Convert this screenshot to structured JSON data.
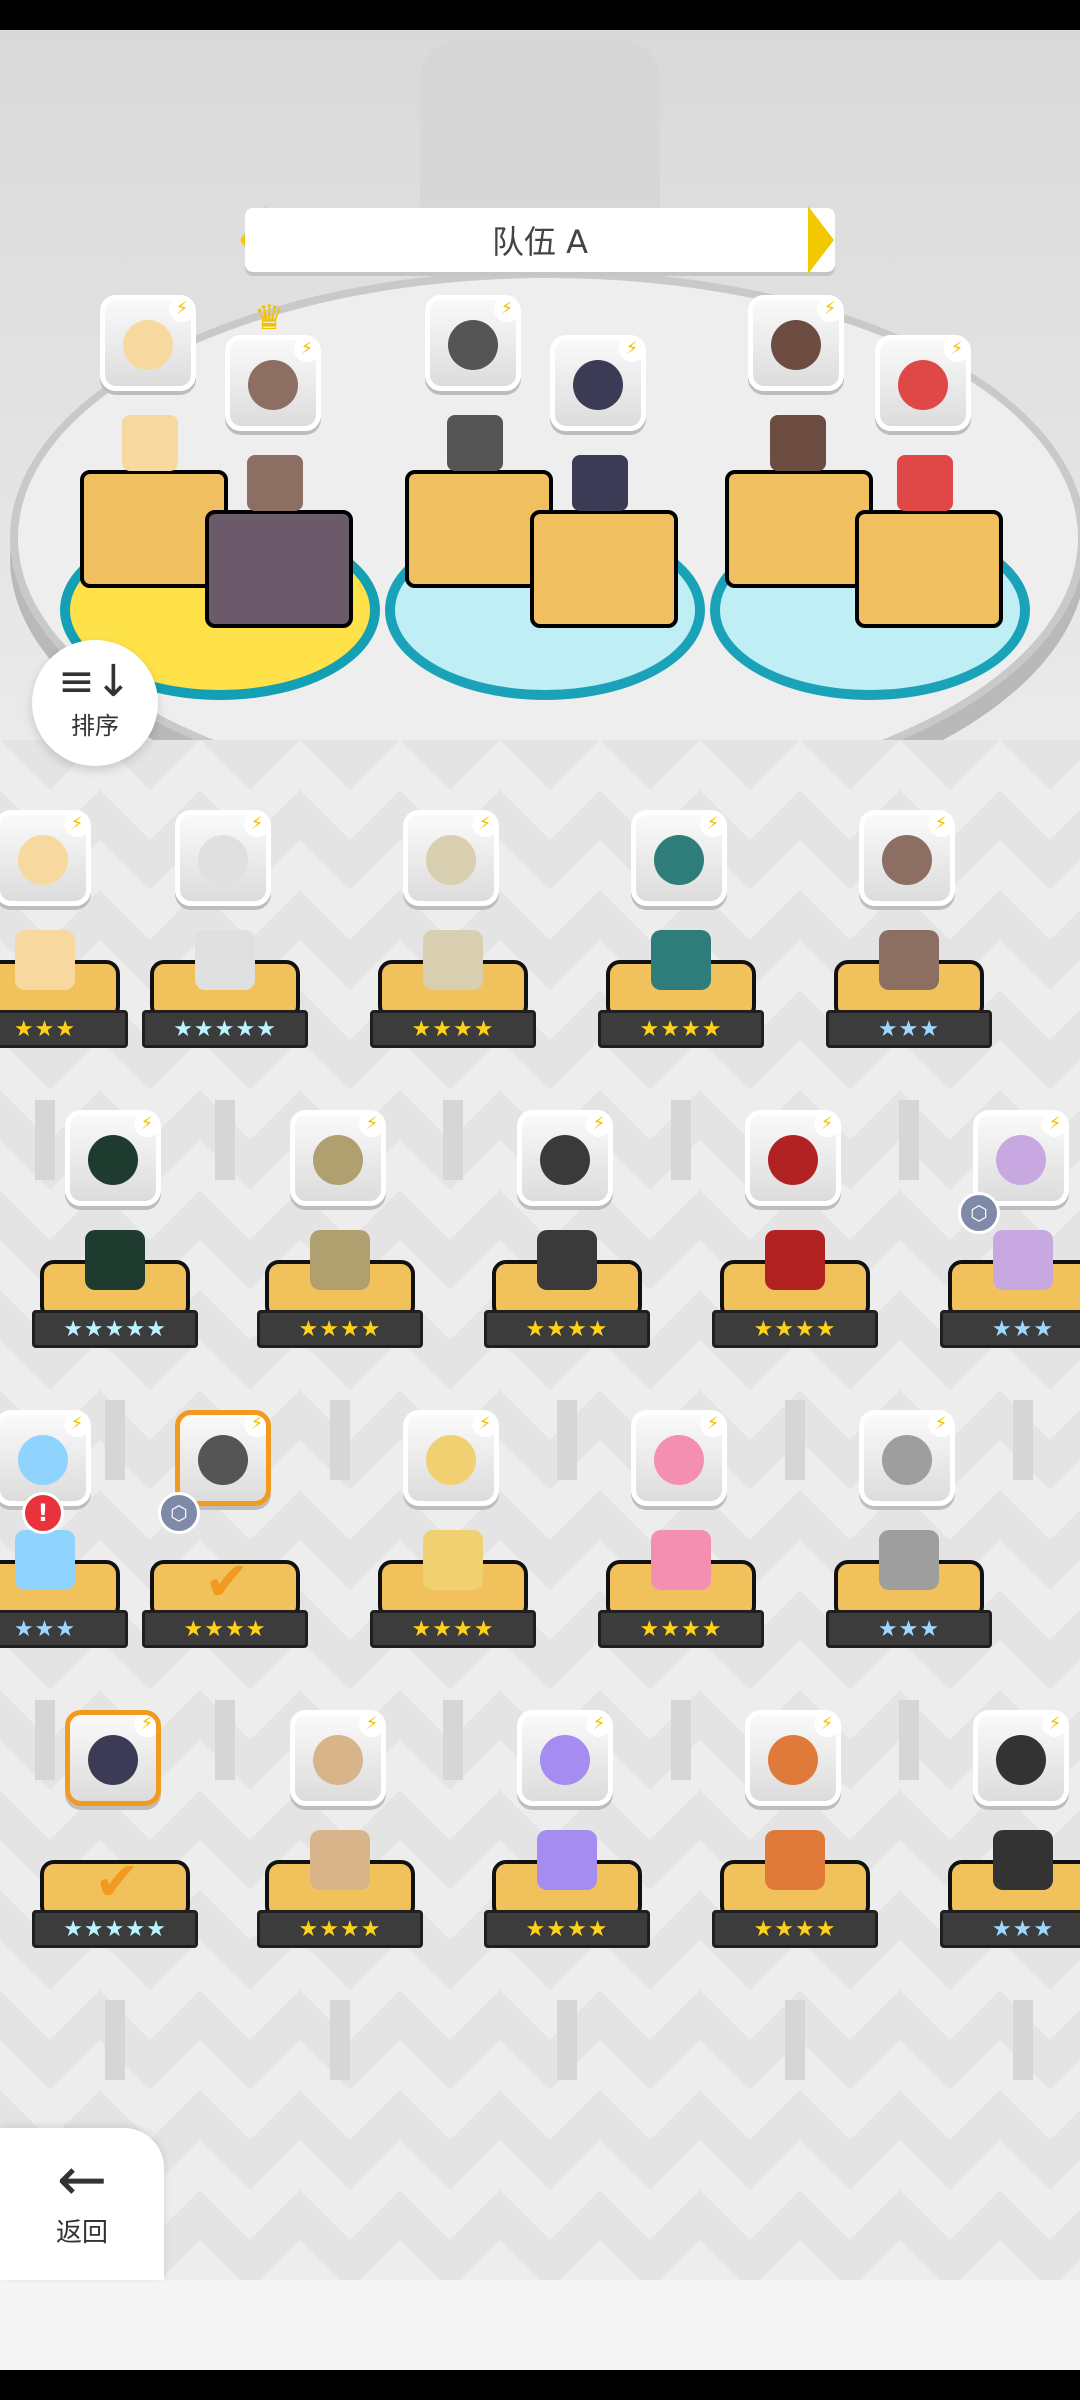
{
  "team": {
    "title": "队伍 A"
  },
  "buttons": {
    "sort_label": "排序",
    "back_label": "返回"
  },
  "colors": {
    "accent_yellow": "#f2c900",
    "selected_orange": "#f29a1f",
    "teal": "#1aa3b8"
  },
  "team_slots": [
    {
      "hero": "blonde-girl",
      "face": "#f7d9a0"
    },
    {
      "hero": "bearded-captain",
      "face": "#8d6e63",
      "leader": true
    },
    {
      "hero": "red-eye-robot",
      "face": "#555555"
    },
    {
      "hero": "dark-knight-robot",
      "face": "#3b3b55"
    },
    {
      "hero": "glasses-girl",
      "face": "#6d4c41"
    },
    {
      "hero": "red-hair-girl",
      "face": "#e04848"
    }
  ],
  "roster": [
    {
      "row": 1,
      "heroes": [
        {
          "face": "#f7d9a0",
          "stars": "★★★",
          "tier": "gold",
          "partial": "left"
        },
        {
          "face": "#e0e0e0",
          "stars": "★★★★★",
          "tier": "rainbow"
        },
        {
          "face": "#d8cfb0",
          "stars": "★★★★",
          "tier": "gold"
        },
        {
          "face": "#2e7d7a",
          "stars": "★★★★",
          "tier": "gold"
        },
        {
          "face": "#8d6e63",
          "stars": "★★★",
          "tier": "blue"
        }
      ]
    },
    {
      "row": 2,
      "heroes": [
        {
          "face": "#1f3b2f",
          "stars": "★★★★★",
          "tier": "rainbow"
        },
        {
          "face": "#b0a070",
          "stars": "★★★★",
          "tier": "gold"
        },
        {
          "face": "#3a3a3a",
          "stars": "★★★★",
          "tier": "gold"
        },
        {
          "face": "#b22222",
          "stars": "★★★★",
          "tier": "gold"
        },
        {
          "face": "#c7a8e0",
          "stars": "★★★",
          "tier": "blue"
        }
      ]
    },
    {
      "row": 3,
      "heroes": [
        {
          "face": "#8fd3ff",
          "stars": "★★★",
          "tier": "blue",
          "partial": "left"
        },
        {
          "face": "#555555",
          "stars": "★★★★",
          "tier": "gold",
          "selected": true
        },
        {
          "face": "#f0d070",
          "stars": "★★★★",
          "tier": "gold"
        },
        {
          "face": "#f48fb1",
          "stars": "★★★★",
          "tier": "gold"
        },
        {
          "face": "#9e9e9e",
          "stars": "★★★",
          "tier": "blue"
        }
      ]
    },
    {
      "row": 4,
      "heroes": [
        {
          "face": "#3b3b55",
          "stars": "★★★★★",
          "tier": "rainbow",
          "selected": true
        },
        {
          "face": "#d8b48a",
          "stars": "★★★★",
          "tier": "gold"
        },
        {
          "face": "#a48cf0",
          "stars": "★★★★",
          "tier": "gold"
        },
        {
          "face": "#e07a3a",
          "stars": "★★★★",
          "tier": "gold"
        },
        {
          "face": "#333333",
          "stars": "★★★",
          "tier": "blue"
        }
      ]
    }
  ]
}
